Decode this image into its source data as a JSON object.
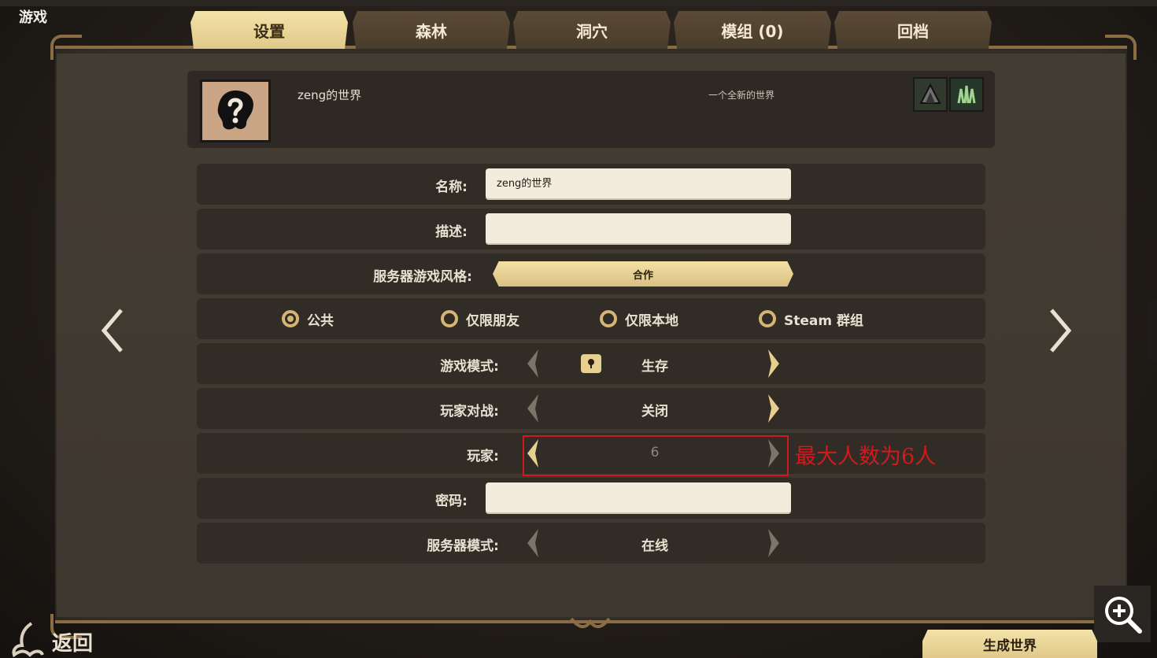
{
  "screen": {
    "title": "游戏"
  },
  "tabs": [
    {
      "label": "设置",
      "active": true
    },
    {
      "label": "森林",
      "active": false
    },
    {
      "label": "洞穴",
      "active": false
    },
    {
      "label": "模组 (0)",
      "active": false
    },
    {
      "label": "回档",
      "active": false
    }
  ],
  "world": {
    "name": "zeng的世界",
    "description": "一个全新的世界",
    "avatar_icon": "question-mark-face-icon",
    "shard_icons": [
      "forest-shard-icon",
      "cave-shard-icon"
    ]
  },
  "form": {
    "name": {
      "label": "名称:",
      "value": "zeng的世界"
    },
    "description": {
      "label": "描述:",
      "value": ""
    },
    "play_style": {
      "label": "服务器游戏风格:",
      "value": "合作"
    },
    "privacy": {
      "options": [
        {
          "label": "公共",
          "checked": true
        },
        {
          "label": "仅限朋友",
          "checked": false
        },
        {
          "label": "仅限本地",
          "checked": false
        },
        {
          "label": "Steam 群组",
          "checked": false
        }
      ]
    },
    "game_mode": {
      "label": "游戏模式:",
      "value": "生存",
      "icon": "survival-icon"
    },
    "pvp": {
      "label": "玩家对战:",
      "value": "关闭"
    },
    "players": {
      "label": "玩家:",
      "value": "6"
    },
    "password": {
      "label": "密码:",
      "value": ""
    },
    "server_mode": {
      "label": "服务器模式:",
      "value": "在线"
    }
  },
  "annotation": {
    "text": "最大人数为6人",
    "color": "#d2191c"
  },
  "bottom": {
    "back_label": "返回",
    "generate_label": "生成世界"
  },
  "colors": {
    "accent_gold": "#e0c98a",
    "frame_brown": "#8a6d44",
    "panel_bg": "#3f3931",
    "row_bg": "#322c27"
  }
}
